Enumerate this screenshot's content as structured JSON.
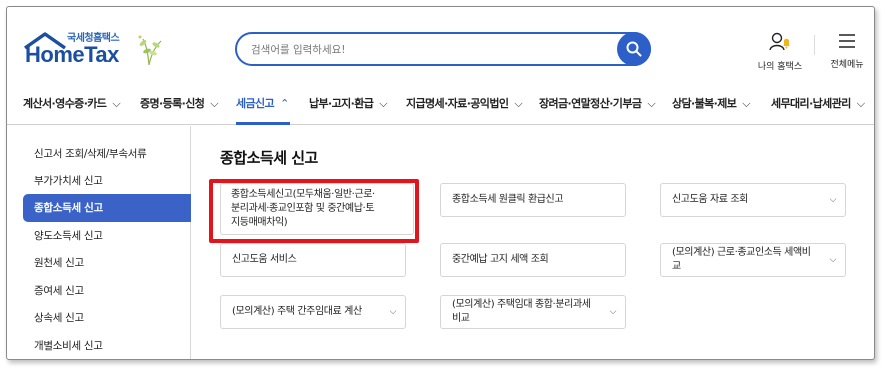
{
  "header": {
    "logo_top": "국세청홈택스",
    "logo_main": "HomeTax",
    "search_placeholder": "검색어를 입력하세요!",
    "my_hometax": "나의 홈택스",
    "all_menu": "전체메뉴",
    "brand_color": "#2d5fc9"
  },
  "nav": {
    "items": [
      {
        "label": "계산서·영수증·카드"
      },
      {
        "label": "증명·등록·신청"
      },
      {
        "label": "세금신고"
      },
      {
        "label": "납부·고지·환급"
      },
      {
        "label": "지급명세·자료·공익법인"
      },
      {
        "label": "장려금·연말정산·기부금"
      },
      {
        "label": "상담·불복·제보"
      },
      {
        "label": "세무대리·납세관리"
      }
    ],
    "active_index": 2
  },
  "sidebar": {
    "items": [
      {
        "label": "신고서 조회/삭제/부속서류"
      },
      {
        "label": "부가가치세 신고"
      },
      {
        "label": "종합소득세 신고"
      },
      {
        "label": "양도소득세 신고"
      },
      {
        "label": "원천세 신고"
      },
      {
        "label": "증여세 신고"
      },
      {
        "label": "상속세 신고"
      },
      {
        "label": "개별소비세 신고"
      }
    ],
    "active_index": 2
  },
  "main": {
    "title": "종합소득세 신고",
    "cards": [
      {
        "line1": "종합소득세신고(모두채움·일반·근로·",
        "line2": "분리과세·종교인포함 및 중간예납·토",
        "line3": "지등매매차익)"
      },
      {
        "label": "종합소득세 원클릭 환급신고"
      },
      {
        "label": "신고도움 자료 조회"
      },
      {
        "label": "신고도움 서비스"
      },
      {
        "label": "중간예납 고지 세액 조회"
      },
      {
        "line1": "(모의계산) 근로·종교인소득 세액비",
        "line2": "교"
      },
      {
        "label": "(모의계산) 주택 간주임대료 계산"
      },
      {
        "line1": "(모의계산) 주택임대 종합·분리과세",
        "line2": "비교"
      }
    ],
    "highlight_color": "#e3151c"
  }
}
